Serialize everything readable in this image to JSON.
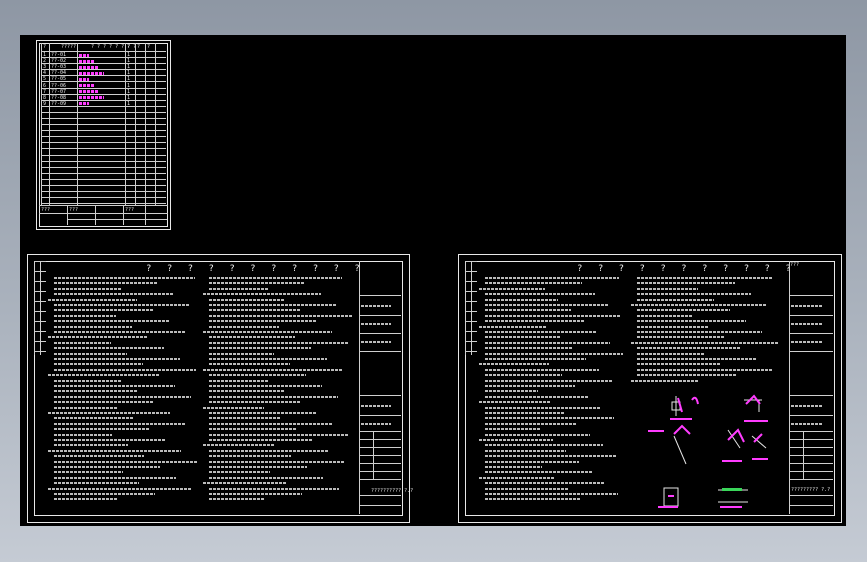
{
  "drawing_list": {
    "header": [
      "?",
      "?????",
      "? ? ? ? ? ? ? ?",
      "?",
      "?",
      "?"
    ],
    "rows": [
      {
        "no": "1",
        "code": "??-01"
      },
      {
        "no": "2",
        "code": "??-02"
      },
      {
        "no": "3",
        "code": "??-03"
      },
      {
        "no": "4",
        "code": "??-04"
      },
      {
        "no": "5",
        "code": "??-05"
      },
      {
        "no": "6",
        "code": "??-06"
      },
      {
        "no": "7",
        "code": "??-07"
      },
      {
        "no": "8",
        "code": "??-08"
      },
      {
        "no": "9",
        "code": "??-09"
      }
    ],
    "footer": [
      "???",
      "???",
      "???"
    ]
  },
  "sheet_left": {
    "title": "? ? ? ? ? ? ? ? ? ?  ?",
    "footer": "??????????  ?.?"
  },
  "sheet_right": {
    "title": "? ? ? ? ? ? ? ? ? ?  ?",
    "corner": "???",
    "footer": "?????????  ?.?"
  },
  "colors": {
    "background": "#000000",
    "frame": "#e8e8e8",
    "highlight": "#ff3cff"
  }
}
